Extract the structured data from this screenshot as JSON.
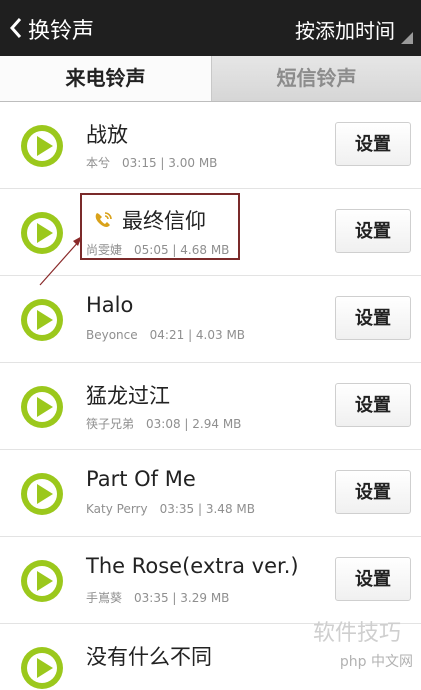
{
  "topbar": {
    "title": "换铃声",
    "sort_label": "按添加时间"
  },
  "tabs": {
    "active": "来电铃声",
    "inactive": "短信铃声"
  },
  "colors": {
    "topbar_bg": "#1f1f1f",
    "play_outer": "#9bc81c",
    "play_inner": "#ffffff",
    "highlight_border": "#7a2a2a"
  },
  "songs": [
    {
      "name": "战放",
      "artist": "本兮",
      "duration": "03:15",
      "size": "3.00 MB",
      "button": "设置"
    },
    {
      "name": "最终信仰",
      "artist": "尚雯婕",
      "duration": "05:05",
      "size": "4.68 MB",
      "button": "设置"
    },
    {
      "name": "Halo",
      "artist": "Beyonce",
      "duration": "04:21",
      "size": "4.03 MB",
      "button": "设置"
    },
    {
      "name": "猛龙过江",
      "artist": "筷子兄弟",
      "duration": "03:08",
      "size": "2.94 MB",
      "button": "设置"
    },
    {
      "name": "Part Of Me",
      "artist": "Katy Perry",
      "duration": "03:35",
      "size": "3.48 MB",
      "button": "设置"
    },
    {
      "name": "The Rose(extra ver.)",
      "artist": "手嶌葵",
      "duration": "03:35",
      "size": "3.29 MB",
      "button": "设置"
    },
    {
      "name": "没有什么不同",
      "artist": "",
      "duration": "",
      "size": "",
      "button": ""
    }
  ],
  "watermark": {
    "main": "软件技巧",
    "sub": "php 中文网"
  }
}
